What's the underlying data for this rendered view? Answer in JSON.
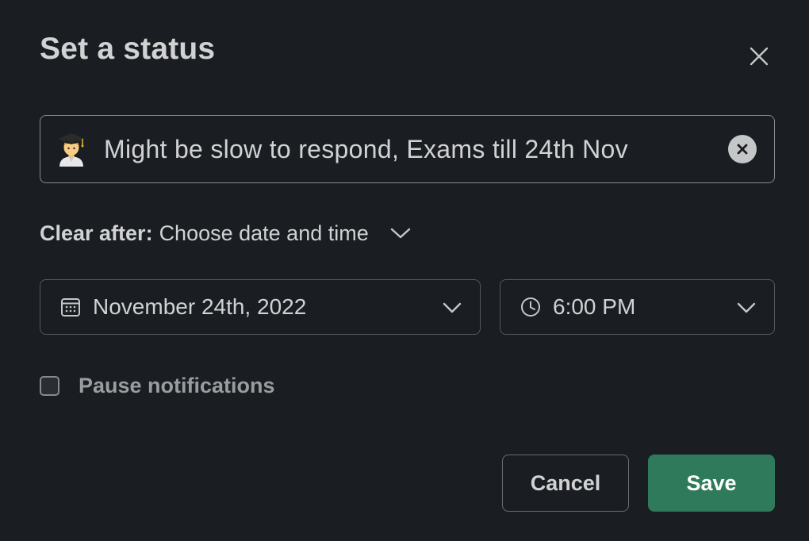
{
  "dialog": {
    "title": "Set a status",
    "close_icon": "close-icon"
  },
  "status_input": {
    "emoji": "student-emoji",
    "value": "Might be slow to respond, Exams till 24th Nov",
    "clear_icon": "clear-circle-icon"
  },
  "clear_after": {
    "label": "Clear after:",
    "value": "Choose date and time"
  },
  "date_select": {
    "icon": "calendar-icon",
    "value": "November 24th, 2022"
  },
  "time_select": {
    "icon": "clock-icon",
    "value": "6:00 PM"
  },
  "pause_notifications": {
    "label": "Pause notifications",
    "checked": false
  },
  "actions": {
    "cancel_label": "Cancel",
    "save_label": "Save"
  },
  "colors": {
    "background": "#1a1d21",
    "text": "#d1d2d3",
    "save_button": "#2f7a5a",
    "border": "#878a8e"
  }
}
